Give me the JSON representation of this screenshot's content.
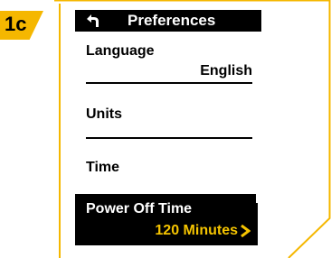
{
  "step": {
    "label": "1c"
  },
  "header": {
    "title": "Preferences",
    "back_icon": "back-arrow-icon"
  },
  "settings": [
    {
      "label": "Language",
      "value": "English"
    },
    {
      "label": "Units",
      "value": ""
    },
    {
      "label": "Time",
      "value": ""
    }
  ],
  "selected": {
    "label": "Power Off Time",
    "value": "120 Minutes",
    "icon": "chevron-right-icon"
  },
  "colors": {
    "accent": "#f5b700",
    "highlight_text": "#f5c400",
    "screen_bg": "#000000"
  }
}
